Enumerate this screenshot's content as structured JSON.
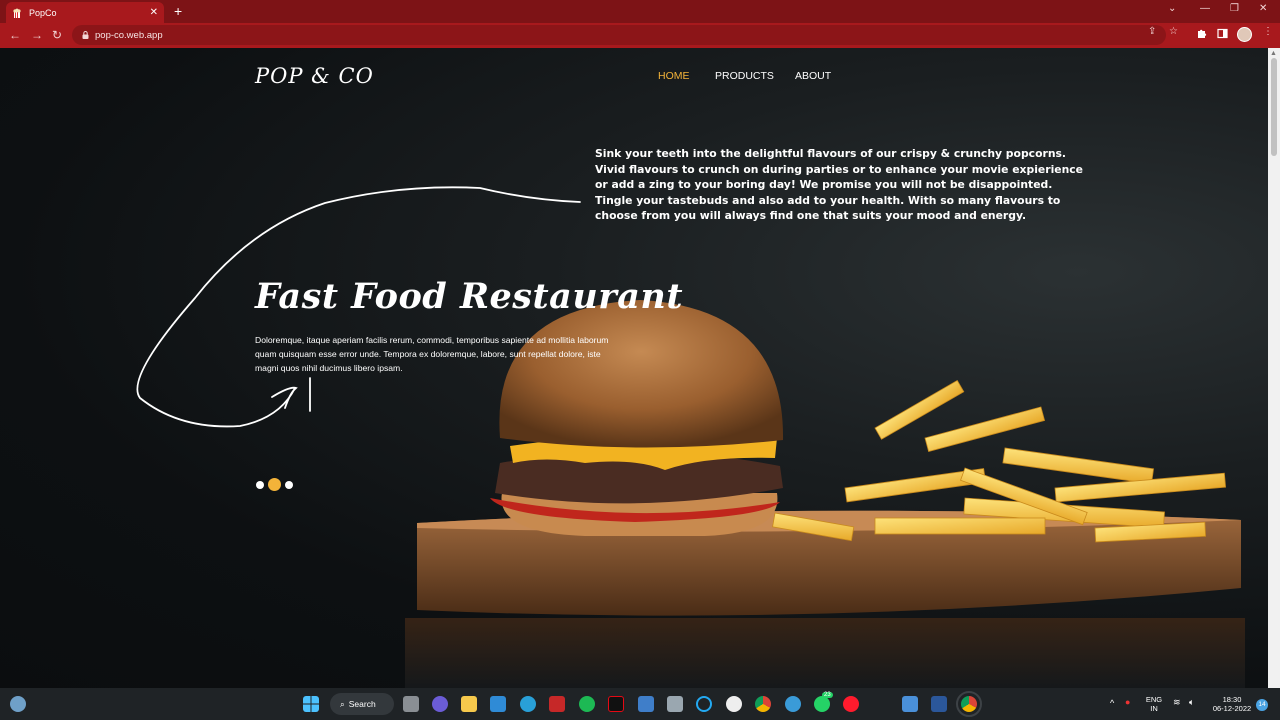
{
  "browser": {
    "tab_title": "PopCo",
    "url": "pop-co.web.app",
    "tab_close": "✕",
    "new_tab": "+"
  },
  "site": {
    "logo": "POP & CO",
    "nav": [
      {
        "label": "HOME",
        "active": true
      },
      {
        "label": "PRODUCTS",
        "active": false
      },
      {
        "label": "ABOUT",
        "active": false
      }
    ],
    "promo_text": "Sink your teeth into the delightful flavours of our crispy & crunchy popcorns. Vivid flavours to crunch on during parties or to enhance your movie expierience or add a zing to your boring day! We promise you will not be disappointed. Tingle your tastebuds and also add to your health. With so many flavours to choose from you will always find one that suits your mood and energy.",
    "hero_title": "Fast Food Restaurant",
    "hero_description": "Doloremque, itaque aperiam facilis rerum, commodi, temporibus sapiente ad mollitia laborum quam quisquam esse error unde. Tempora ex doloremque, labore, sunt repellat dolore, iste magni quos nihil ducimus libero ipsam.",
    "slider_dots": 3,
    "active_slide": 2,
    "accent_color": "#f3b339"
  },
  "taskbar": {
    "search_label": "Search",
    "lang_line1": "ENG",
    "lang_line2": "IN",
    "time": "18:30",
    "date": "06-12-2022",
    "notification_count": "14",
    "whatsapp_badge": "23"
  }
}
